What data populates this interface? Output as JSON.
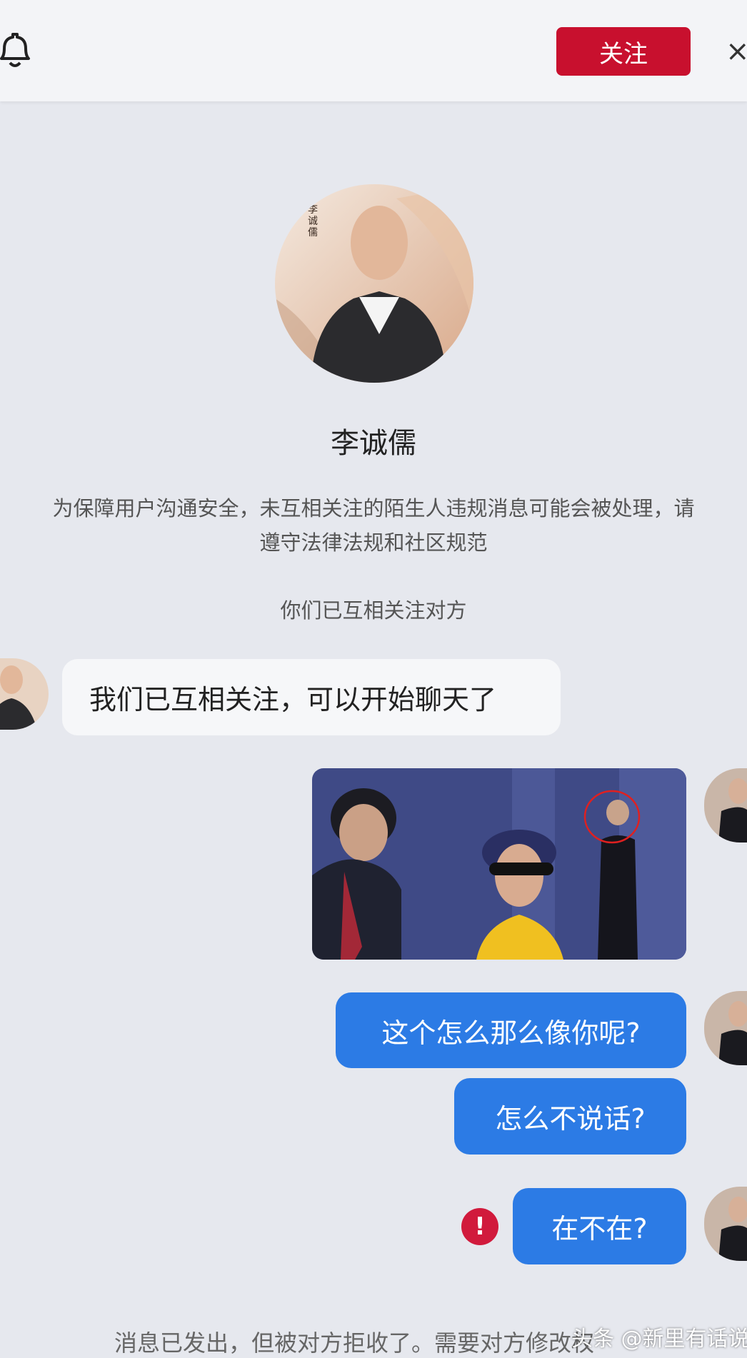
{
  "header": {
    "follow_label": "关注",
    "close_glyph": "×"
  },
  "profile": {
    "name": "李诚儒",
    "avatar_caption": "李诚儒",
    "safety_notice": "为保障用户沟通安全，未互相关注的陌生人违规消息可能会被处理，请遵守法律法规和社区规范",
    "mutual_status": "你们已互相关注对方"
  },
  "messages": {
    "incoming_1": "我们已互相关注，可以开始聊天了",
    "outgoing_1": "这个怎么那么像你呢?",
    "outgoing_2": "怎么不说话?",
    "outgoing_3": "在不在?"
  },
  "footer": {
    "rejected_notice": "消息已发出，但被对方拒收了。需要对方修改权",
    "watermark": "头条 @新里有话说"
  },
  "colors": {
    "follow_button": "#c8102e",
    "outgoing_bubble": "#2c7be5",
    "error_icon": "#d11a3c"
  }
}
